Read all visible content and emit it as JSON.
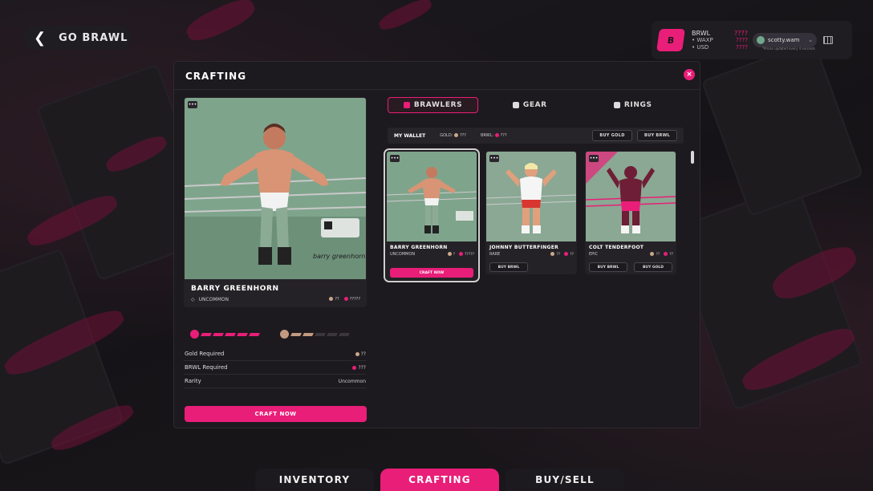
{
  "back": {
    "label": "GO BRAWL"
  },
  "wallet": {
    "logo": "B",
    "token": "BRWL",
    "token_value": "????",
    "rows": [
      {
        "label": "• WAXP",
        "value": "????"
      },
      {
        "label": "• USD",
        "value": "????"
      }
    ],
    "user": "scotty.wam",
    "note": "*Prices updated every 4 seconds"
  },
  "modal": {
    "title": "CRAFTING",
    "close": "×"
  },
  "selected": {
    "menu": "•••",
    "name": "BARRY GREENHORN",
    "rarity": "UNCOMMON",
    "gold": "??",
    "brwl": "?????",
    "requirements": [
      {
        "label": "Gold Required",
        "value": "??"
      },
      {
        "label": "BRWL Required",
        "value": "???"
      },
      {
        "label": "Rarity",
        "value": "Uncommon"
      }
    ],
    "craft_label": "CRAFT NOW",
    "progress_brwl_filled": 5,
    "progress_gold_filled": 2
  },
  "tabs": [
    {
      "label": "BRAWLERS",
      "icon": "brawler-icon"
    },
    {
      "label": "GEAR",
      "icon": "gear-icon"
    },
    {
      "label": "RINGS",
      "icon": "ring-icon"
    }
  ],
  "walletbar": {
    "title": "MY WALLET",
    "gold_label": "GOLD:",
    "gold_value": "???",
    "brwl_label": "BRWL:",
    "brwl_value": "???",
    "buy_gold": "BUY GOLD",
    "buy_brwl": "BUY BRWL"
  },
  "cards": [
    {
      "name": "BARRY GREENHORN",
      "rarity": "UNCOMMON",
      "gold": "?",
      "brwl": "?????",
      "action": "CRAFT NOW"
    },
    {
      "name": "JOHNNY BUTTERFINGER",
      "rarity": "RARE",
      "gold": "??",
      "brwl": "??",
      "action": "BUY BRWL"
    },
    {
      "name": "COLT TENDERFOOT",
      "rarity": "EPIC",
      "gold": "??",
      "brwl": "??",
      "action": "BUY BRWL",
      "action2": "BUY GOLD"
    }
  ],
  "bottom_tabs": [
    {
      "label": "INVENTORY"
    },
    {
      "label": "CRAFTING"
    },
    {
      "label": "BUY/SELL"
    }
  ]
}
